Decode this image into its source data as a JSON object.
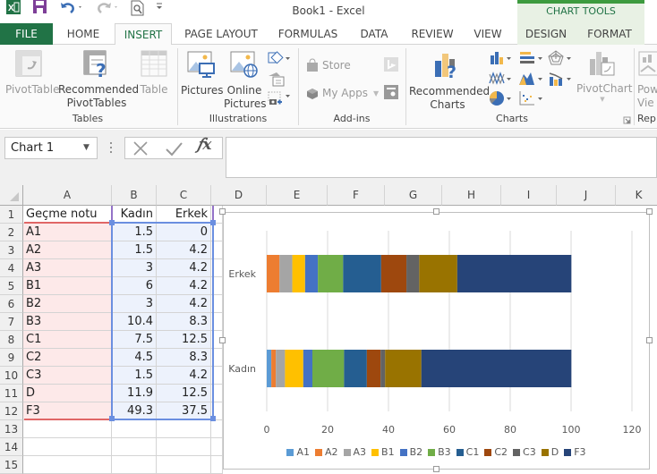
{
  "window": {
    "title": "Book1 - Excel",
    "contextual_group": "CHART TOOLS"
  },
  "quick_access": {
    "icons": [
      "excel-logo-icon",
      "save-icon",
      "undo-icon",
      "redo-icon",
      "print-preview-icon",
      "customize-qat-icon"
    ]
  },
  "tabs": [
    {
      "label": "FILE"
    },
    {
      "label": "HOME"
    },
    {
      "label": "INSERT"
    },
    {
      "label": "PAGE LAYOUT"
    },
    {
      "label": "FORMULAS"
    },
    {
      "label": "DATA"
    },
    {
      "label": "REVIEW"
    },
    {
      "label": "VIEW"
    },
    {
      "label": "DESIGN"
    },
    {
      "label": "FORMAT"
    }
  ],
  "active_tab": "INSERT",
  "ribbon": {
    "groups": [
      {
        "label": "Tables",
        "items": [
          {
            "label": "PivotTable",
            "disabled": true
          },
          {
            "label": "Recommended PivotTables",
            "line1": "Recommended",
            "line2": "PivotTables"
          },
          {
            "label": "Table",
            "disabled": true
          }
        ]
      },
      {
        "label": "Illustrations",
        "items": [
          {
            "label": "Pictures"
          },
          {
            "label": "Online Pictures",
            "line1": "Online",
            "line2": "Pictures"
          }
        ]
      },
      {
        "label": "Add-ins",
        "items": [
          {
            "label": "Store",
            "disabled": true
          },
          {
            "label": "My Apps",
            "disabled": true
          }
        ]
      },
      {
        "label": "Charts",
        "items": [
          {
            "label": "Recommended Charts",
            "line1": "Recommended",
            "line2": "Charts"
          },
          {
            "label": "PivotChart",
            "disabled": true
          }
        ]
      },
      {
        "label": "Rep",
        "items": [
          {
            "label": "Pow",
            "line1": "Pow",
            "line2": "Vie"
          }
        ]
      }
    ]
  },
  "formula_bar": {
    "name_box": "Chart 1",
    "formula": ""
  },
  "sheet": {
    "columns": [
      "A",
      "B",
      "C",
      "D",
      "E",
      "F",
      "G",
      "H",
      "I",
      "J",
      "K"
    ],
    "rows": [
      "1",
      "2",
      "3",
      "4",
      "5",
      "6",
      "7",
      "8",
      "9",
      "10",
      "11",
      "12",
      "13",
      "14",
      "15"
    ],
    "header": [
      "Geçme notu",
      "Kadın",
      "Erkek"
    ],
    "data": [
      [
        "A1",
        "1.5",
        "0"
      ],
      [
        "A2",
        "1.5",
        "4.2"
      ],
      [
        "A3",
        "3",
        "4.2"
      ],
      [
        "B1",
        "6",
        "4.2"
      ],
      [
        "B2",
        "3",
        "4.2"
      ],
      [
        "B3",
        "10.4",
        "8.3"
      ],
      [
        "C1",
        "7.5",
        "12.5"
      ],
      [
        "C2",
        "4.5",
        "8.3"
      ],
      [
        "C3",
        "1.5",
        "4.2"
      ],
      [
        "D",
        "11.9",
        "12.5"
      ],
      [
        "F3",
        "49.3",
        "37.5"
      ]
    ]
  },
  "chart_data": {
    "type": "bar",
    "orientation": "horizontal",
    "stacked": true,
    "title": "",
    "categories": [
      "Kadın",
      "Erkek"
    ],
    "series": [
      {
        "name": "A1",
        "values": [
          1.5,
          0
        ],
        "color": "#5b9bd5"
      },
      {
        "name": "A2",
        "values": [
          1.5,
          4.2
        ],
        "color": "#ed7d31"
      },
      {
        "name": "A3",
        "values": [
          3,
          4.2
        ],
        "color": "#a5a5a5"
      },
      {
        "name": "B1",
        "values": [
          6,
          4.2
        ],
        "color": "#ffc000"
      },
      {
        "name": "B2",
        "values": [
          3,
          4.2
        ],
        "color": "#4472c4"
      },
      {
        "name": "B3",
        "values": [
          10.4,
          8.3
        ],
        "color": "#70ad47"
      },
      {
        "name": "C1",
        "values": [
          7.5,
          12.5
        ],
        "color": "#255e91"
      },
      {
        "name": "C2",
        "values": [
          4.5,
          8.3
        ],
        "color": "#9e480e"
      },
      {
        "name": "C3",
        "values": [
          1.5,
          4.2
        ],
        "color": "#636363"
      },
      {
        "name": "D",
        "values": [
          11.9,
          12.5
        ],
        "color": "#997300"
      },
      {
        "name": "F3",
        "values": [
          49.3,
          37.5
        ],
        "color": "#264478"
      }
    ],
    "xlim": [
      0,
      120
    ],
    "xticks": [
      "0",
      "20",
      "40",
      "60",
      "80",
      "100",
      "120"
    ],
    "grid": true,
    "legend": "bottom"
  }
}
